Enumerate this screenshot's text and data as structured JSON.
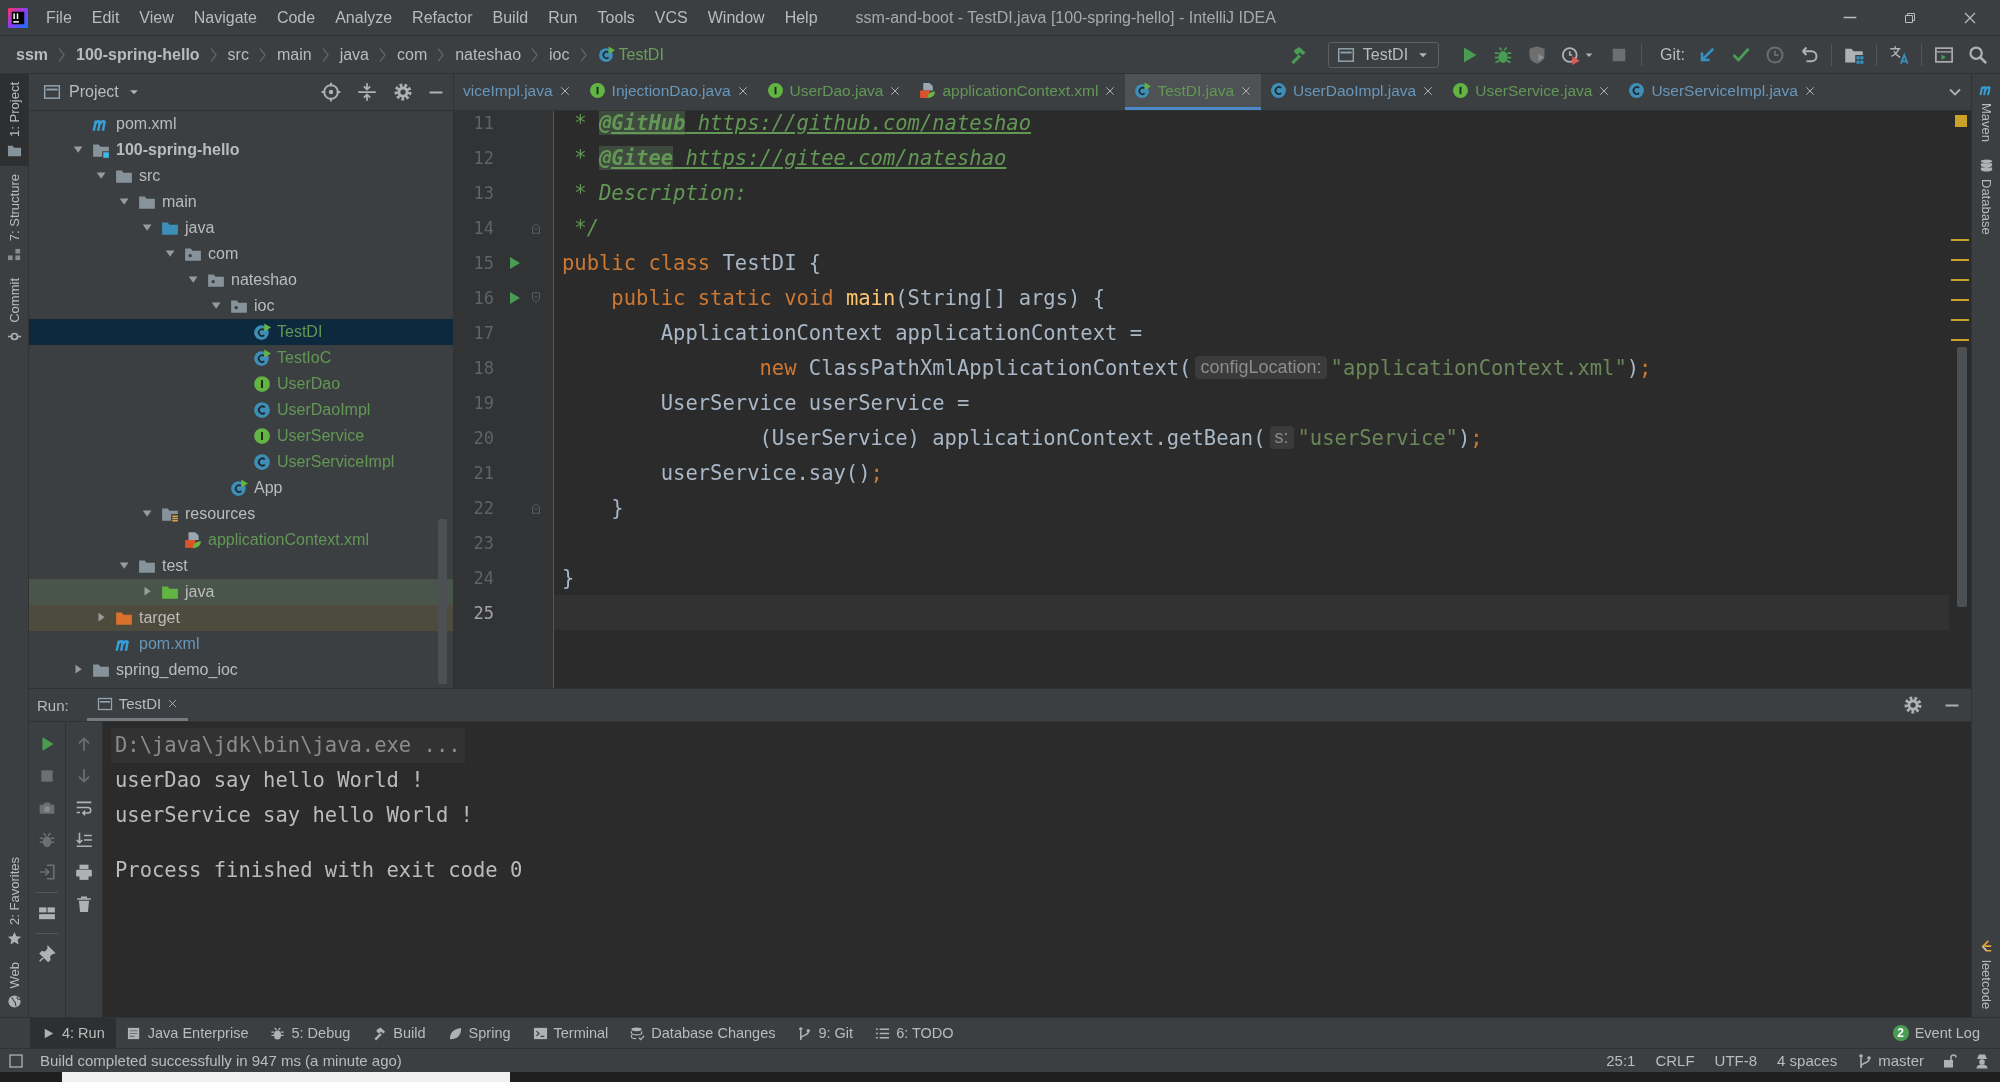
{
  "window": {
    "title": "ssm-and-boot - TestDI.java [100-spring-hello] - IntelliJ IDEA"
  },
  "menu": [
    "File",
    "Edit",
    "View",
    "Navigate",
    "Code",
    "Analyze",
    "Refactor",
    "Build",
    "Run",
    "Tools",
    "VCS",
    "Window",
    "Help"
  ],
  "breadcrumbs": [
    {
      "label": "ssm",
      "kind": "project"
    },
    {
      "label": "100-spring-hello",
      "kind": "module"
    },
    {
      "label": "src",
      "kind": "dir"
    },
    {
      "label": "main",
      "kind": "dir"
    },
    {
      "label": "java",
      "kind": "dir"
    },
    {
      "label": "com",
      "kind": "dir"
    },
    {
      "label": "nateshao",
      "kind": "dir"
    },
    {
      "label": "ioc",
      "kind": "dir"
    },
    {
      "label": "TestDI",
      "kind": "class"
    }
  ],
  "run_config": {
    "label": "TestDI"
  },
  "git_label": "Git:",
  "left_tool_strip": [
    {
      "label": "1: Project",
      "selected": true
    },
    {
      "label": "7: Structure",
      "selected": false
    },
    {
      "label": "Commit",
      "selected": false
    },
    {
      "label": "2: Favorites",
      "selected": false
    },
    {
      "label": "Web",
      "selected": false
    }
  ],
  "right_tool_strip": [
    {
      "label": "Maven"
    },
    {
      "label": "Database"
    },
    {
      "label": "leetcode"
    }
  ],
  "project_panel": {
    "title": "Project",
    "tree": [
      {
        "label": "pom.xml",
        "kind": "maven",
        "selected": false
      },
      {
        "label": "100-spring-hello",
        "kind": "module",
        "expanded": true,
        "selected": false,
        "children": [
          {
            "label": "src",
            "kind": "folder",
            "expanded": true,
            "selected": false,
            "children": [
              {
                "label": "main",
                "kind": "folder",
                "expanded": true,
                "selected": false,
                "children": [
                  {
                    "label": "java",
                    "kind": "source-folder",
                    "expanded": true,
                    "selected": false,
                    "children": [
                      {
                        "label": "com",
                        "kind": "package",
                        "expanded": true,
                        "selected": false,
                        "children": [
                          {
                            "label": "nateshao",
                            "kind": "package",
                            "expanded": true,
                            "selected": false,
                            "children": [
                              {
                                "label": "ioc",
                                "kind": "package",
                                "expanded": true,
                                "selected": false,
                                "children": [
                                  {
                                    "label": "TestDI",
                                    "kind": "class-run",
                                    "color": "#629755",
                                    "selected": true
                                  },
                                  {
                                    "label": "TestIoC",
                                    "kind": "class-run",
                                    "color": "#629755",
                                    "selected": false
                                  },
                                  {
                                    "label": "UserDao",
                                    "kind": "interface",
                                    "color": "#629755",
                                    "selected": false
                                  },
                                  {
                                    "label": "UserDaoImpl",
                                    "kind": "class",
                                    "color": "#629755",
                                    "selected": false
                                  },
                                  {
                                    "label": "UserService",
                                    "kind": "interface",
                                    "color": "#629755",
                                    "selected": false
                                  },
                                  {
                                    "label": "UserServiceImpl",
                                    "kind": "class",
                                    "color": "#629755",
                                    "selected": false
                                  }
                                ]
                              },
                              {
                                "label": "App",
                                "kind": "class-run",
                                "selected": false
                              }
                            ]
                          }
                        ]
                      }
                    ]
                  },
                  {
                    "label": "resources",
                    "kind": "resources",
                    "expanded": true,
                    "selected": false,
                    "children": [
                      {
                        "label": "applicationContext.xml",
                        "kind": "spring-xml",
                        "color": "#629755",
                        "selected": false
                      }
                    ]
                  }
                ]
              },
              {
                "label": "test",
                "kind": "folder",
                "expanded": true,
                "selected": false,
                "children": [
                  {
                    "label": "java",
                    "kind": "test-folder",
                    "expanded": false,
                    "selected": false
                  }
                ]
              }
            ]
          },
          {
            "label": "target",
            "kind": "excluded-folder",
            "expanded": false,
            "selected": false
          },
          {
            "label": "pom.xml",
            "kind": "maven",
            "color": "#6897bb",
            "selected": false
          }
        ]
      },
      {
        "label": "spring_demo_ioc",
        "kind": "folder",
        "expanded": false,
        "selected": false
      }
    ]
  },
  "editor_tabs": [
    {
      "label": "viceImpl.java",
      "color": "#6897bb",
      "selected": false
    },
    {
      "label": "InjectionDao.java",
      "kind": "interface",
      "color": "#6897bb",
      "selected": false
    },
    {
      "label": "UserDao.java",
      "kind": "interface",
      "color": "#629755",
      "selected": false
    },
    {
      "label": "applicationContext.xml",
      "kind": "spring-xml",
      "color": "#629755",
      "selected": false
    },
    {
      "label": "TestDI.java",
      "kind": "class-run",
      "color": "#629755",
      "selected": true
    },
    {
      "label": "UserDaoImpl.java",
      "kind": "class",
      "color": "#6897bb",
      "selected": false
    },
    {
      "label": "UserService.java",
      "kind": "interface",
      "color": "#629755",
      "selected": false
    },
    {
      "label": "UserServiceImpl.java",
      "kind": "class",
      "color": "#6897bb",
      "selected": false
    }
  ],
  "editor": {
    "lines": [
      {
        "number": "11",
        "current": false,
        "run": false,
        "fold_start": false,
        "fold_end": false,
        "tokens": [
          {
            "kind": "comment",
            "text": " * "
          },
          {
            "kind": "doctag",
            "text": "@GitHub"
          },
          {
            "kind": "link",
            "text": " https://github.com/nateshao"
          }
        ]
      },
      {
        "number": "12",
        "current": false,
        "run": false,
        "fold_start": false,
        "fold_end": false,
        "tokens": [
          {
            "kind": "comment",
            "text": " * "
          },
          {
            "kind": "doctag",
            "text": "@Gitee"
          },
          {
            "kind": "link",
            "text": " https://gitee.com/nateshao"
          }
        ]
      },
      {
        "number": "13",
        "current": false,
        "run": false,
        "fold_start": false,
        "fold_end": false,
        "tokens": [
          {
            "kind": "comment",
            "text": " * Description:"
          }
        ]
      },
      {
        "number": "14",
        "current": false,
        "run": false,
        "fold_start": false,
        "fold_end": true,
        "tokens": [
          {
            "kind": "comment",
            "text": " */"
          }
        ]
      },
      {
        "number": "15",
        "current": false,
        "run": true,
        "fold_start": false,
        "fold_end": false,
        "tokens": [
          {
            "kind": "kw",
            "text": "public class "
          },
          {
            "kind": "plain",
            "text": "TestDI {"
          }
        ]
      },
      {
        "number": "16",
        "current": false,
        "run": true,
        "fold_start": true,
        "fold_end": false,
        "tokens": [
          {
            "kind": "kw",
            "text": "    public static void "
          },
          {
            "kind": "fn",
            "text": "main"
          },
          {
            "kind": "plain",
            "text": "(String[] args) {"
          }
        ]
      },
      {
        "number": "17",
        "current": false,
        "run": false,
        "fold_start": false,
        "fold_end": false,
        "tokens": [
          {
            "kind": "plain",
            "text": "        ApplicationContext applicationContext ="
          }
        ]
      },
      {
        "number": "18",
        "current": false,
        "run": false,
        "fold_start": false,
        "fold_end": false,
        "tokens": [
          {
            "kind": "kw",
            "text": "                new "
          },
          {
            "kind": "plain",
            "text": "ClassPathXmlApplicationContext("
          },
          {
            "kind": "hint",
            "text": "configLocation:"
          },
          {
            "kind": "str",
            "text": "\"applicationContext.xml\""
          },
          {
            "kind": "plain",
            "text": ")"
          },
          {
            "kind": "kw",
            "text": ";"
          }
        ]
      },
      {
        "number": "19",
        "current": false,
        "run": false,
        "fold_start": false,
        "fold_end": false,
        "tokens": [
          {
            "kind": "plain",
            "text": "        UserService userService ="
          }
        ]
      },
      {
        "number": "20",
        "current": false,
        "run": false,
        "fold_start": false,
        "fold_end": false,
        "tokens": [
          {
            "kind": "plain",
            "text": "                (UserService) applicationContext.getBean("
          },
          {
            "kind": "hint",
            "text": "s:"
          },
          {
            "kind": "str",
            "text": "\"userService\""
          },
          {
            "kind": "plain",
            "text": ")"
          },
          {
            "kind": "kw",
            "text": ";"
          }
        ]
      },
      {
        "number": "21",
        "current": false,
        "run": false,
        "fold_start": false,
        "fold_end": false,
        "tokens": [
          {
            "kind": "plain",
            "text": "        userService.say()"
          },
          {
            "kind": "kw",
            "text": ";"
          }
        ]
      },
      {
        "number": "22",
        "current": false,
        "run": false,
        "fold_start": false,
        "fold_end": true,
        "tokens": [
          {
            "kind": "plain",
            "text": "    }"
          }
        ]
      },
      {
        "number": "23",
        "current": false,
        "run": false,
        "fold_start": false,
        "fold_end": false
      },
      {
        "number": "24",
        "current": false,
        "run": false,
        "fold_start": false,
        "fold_end": false,
        "tokens": [
          {
            "kind": "plain",
            "text": "}"
          }
        ]
      },
      {
        "number": "25",
        "current": true,
        "run": false,
        "fold_start": false,
        "fold_end": false
      }
    ]
  },
  "run_panel": {
    "label": "Run:",
    "tabs": [
      {
        "label": "TestDI",
        "selected": true
      }
    ],
    "console": [
      {
        "kind": "command",
        "text": "D:\\java\\jdk\\bin\\java.exe ..."
      },
      {
        "kind": "output",
        "text": "userDao say hello World !"
      },
      {
        "kind": "output",
        "text": "userService say hello World !"
      },
      {
        "kind": "exit",
        "text": "Process finished with exit code 0"
      }
    ]
  },
  "tool_window_bar": [
    {
      "label": "4: Run",
      "selected": true
    },
    {
      "label": "Java Enterprise",
      "selected": false
    },
    {
      "label": "5: Debug",
      "selected": false
    },
    {
      "label": "Build",
      "selected": false
    },
    {
      "label": "Spring",
      "selected": false
    },
    {
      "label": "Terminal",
      "selected": false
    },
    {
      "label": "Database Changes",
      "selected": false
    },
    {
      "label": "9: Git",
      "selected": false
    },
    {
      "label": "6: TODO",
      "selected": false
    }
  ],
  "event_log": {
    "label": "Event Log",
    "count": "2"
  },
  "status_bar": {
    "message": "Build completed successfully in 947 ms (a minute ago)",
    "items": [
      "25:1",
      "CRLF",
      "UTF-8",
      "4 spaces"
    ],
    "branch": "master"
  }
}
